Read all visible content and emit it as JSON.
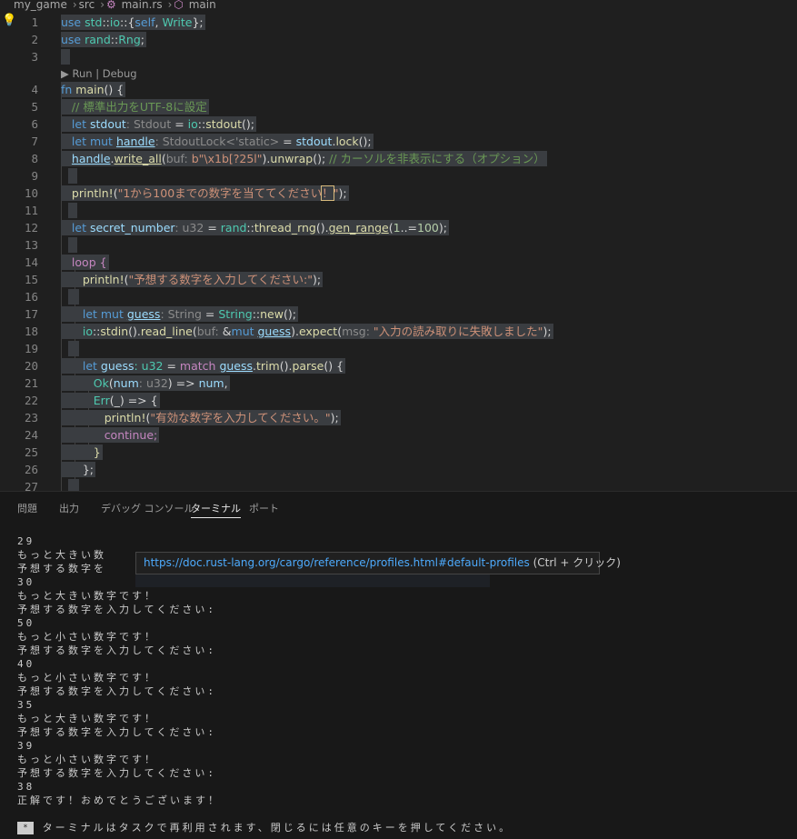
{
  "breadcrumb": {
    "items": [
      "my_game",
      "src",
      "main.rs",
      "main"
    ]
  },
  "editor": {
    "codelens": "▶ Run | Debug",
    "lines": [
      {
        "n": "1"
      },
      {
        "n": "2"
      },
      {
        "n": "3"
      },
      {
        "n": "4"
      },
      {
        "n": "5"
      },
      {
        "n": "6"
      },
      {
        "n": "7"
      },
      {
        "n": "8"
      },
      {
        "n": "9"
      },
      {
        "n": "10"
      },
      {
        "n": "11"
      },
      {
        "n": "12"
      },
      {
        "n": "13"
      },
      {
        "n": "14"
      },
      {
        "n": "15"
      },
      {
        "n": "16"
      },
      {
        "n": "17"
      },
      {
        "n": "18"
      },
      {
        "n": "19"
      },
      {
        "n": "20"
      },
      {
        "n": "21"
      },
      {
        "n": "22"
      },
      {
        "n": "23"
      },
      {
        "n": "24"
      },
      {
        "n": "25"
      },
      {
        "n": "26"
      },
      {
        "n": "27"
      }
    ],
    "code": {
      "l1a": "use",
      "l1b": " std",
      "l1c": "::",
      "l1d": "io",
      "l1e": "::{",
      "l1f": "self",
      "l1g": ", ",
      "l1h": "Write",
      "l1i": "};",
      "l2a": "use",
      "l2b": " rand",
      "l2c": "::",
      "l2d": "Rng",
      "l2e": ";",
      "l4a": "fn",
      "l4b": " main",
      "l4c": "() {",
      "l5": "// 標準出力をUTF-8に設定",
      "l6a": "let",
      "l6b": " stdout",
      "l6c": ": Stdout",
      "l6d": " = ",
      "l6e": "io",
      "l6f": "::",
      "l6g": "stdout",
      "l6h": "();",
      "l7a": "let mut",
      "l7b": "handle",
      "l7c": ": StdoutLock<'static>",
      "l7d": " = ",
      "l7e": "stdout",
      "l7f": ".",
      "l7g": "lock",
      "l7h": "();",
      "l8a": "handle",
      "l8b": ".",
      "l8c": "write_all",
      "l8d": "(",
      "l8e": "buf:",
      "l8f": " b\"\\x1b[?25l\"",
      "l8g": ").",
      "l8h": "unwrap",
      "l8i": "(); ",
      "l8j": "// カーソルを非表示にする（オプション）",
      "l10a": "println!",
      "l10b": "(",
      "l10c": "\"1から100までの数字を当ててください",
      "l10d": "！",
      "l10e": "\"",
      "l10f": ");",
      "l12a": "let",
      "l12b": " secret_number",
      "l12c": ": u32",
      "l12d": " = ",
      "l12e": "rand",
      "l12f": "::",
      "l12g": "thread_rng",
      "l12h": "().",
      "l12i": "gen_range",
      "l12j": "(",
      "l12k": "1",
      "l12l": "..=",
      "l12m": "100",
      "l12n": ");",
      "l14": "loop {",
      "l15a": "println!",
      "l15b": "(",
      "l15c": "\"予想する数字を入力してください:\"",
      "l15d": ");",
      "l17a": "let mut",
      "l17b": "guess",
      "l17c": ": String",
      "l17d": " = ",
      "l17e": "String",
      "l17f": "::",
      "l17g": "new",
      "l17h": "();",
      "l18a": "io",
      "l18b": "::",
      "l18c": "stdin",
      "l18d": "().",
      "l18e": "read_line",
      "l18f": "(",
      "l18g": "buf:",
      "l18h": " &",
      "l18i": "mut",
      "l18j": "guess",
      "l18k": ").",
      "l18l": "expect",
      "l18m": "(",
      "l18n": "msg:",
      "l18o": " \"入力の読み取りに失敗しました\"",
      "l18p": ");",
      "l20a": "let",
      "l20b": " guess",
      "l20c": ": u32",
      "l20d": " = ",
      "l20e": "match",
      "l20f": "guess",
      "l20g": ".",
      "l20h": "trim",
      "l20i": "().",
      "l20j": "parse",
      "l20k": "() {",
      "l21a": "Ok",
      "l21b": "(",
      "l21c": "num",
      "l21d": ": u32",
      "l21e": ") => ",
      "l21f": "num",
      "l21g": ",",
      "l22a": "Err",
      "l22b": "(_) => {",
      "l23a": "println!",
      "l23b": "(",
      "l23c": "\"有効な数字を入力してください。\"",
      "l23d": ");",
      "l24": "continue;",
      "l25": "}",
      "l26": "};"
    }
  },
  "panel": {
    "tabs": [
      "問題",
      "出力",
      "デバッグ コンソール",
      "ターミナル",
      "ポート"
    ],
    "active_tab": "ターミナル",
    "terminal_lines": [
      "29",
      "もっと大きい数",
      "予想する数字を",
      "30",
      "もっと大きい数字です！",
      "予想する数字を入力してください:",
      "50",
      "もっと小さい数字です！",
      "予想する数字を入力してください:",
      "40",
      "もっと小さい数字です！",
      "予想する数字を入力してください:",
      "35",
      "もっと大きい数字です！",
      "予想する数字を入力してください:",
      "39",
      "もっと小さい数字です！",
      "予想する数字を入力してください:",
      "38",
      "正解です！おめでとうございます！"
    ],
    "reuse_marker": "*",
    "reuse_message": "ターミナルはタスクで再利用されます、閉じるには任意のキーを押してください。",
    "tooltip_link": "https://doc.rust-lang.org/cargo/reference/profiles.html#default-profiles",
    "tooltip_hint": " (Ctrl + クリック)"
  },
  "colors": {
    "keyword": "#569cd6",
    "control": "#c586c0",
    "function": "#dcdcaa",
    "type": "#4ec9b0",
    "variable": "#9cdcfe",
    "string": "#ce9178",
    "number": "#b5cea8",
    "comment": "#6a9955",
    "link": "#4daafc"
  }
}
